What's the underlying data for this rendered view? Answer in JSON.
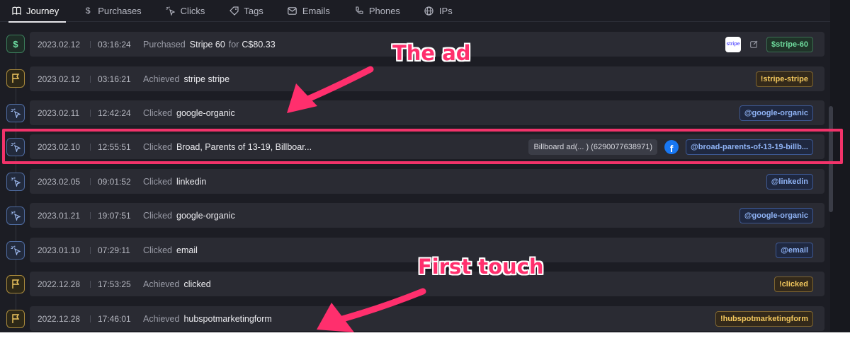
{
  "tabs": [
    {
      "label": "Journey",
      "icon": "book-icon"
    },
    {
      "label": "Purchases",
      "icon": "dollar-icon"
    },
    {
      "label": "Clicks",
      "icon": "pointer-click-icon"
    },
    {
      "label": "Tags",
      "icon": "tag-icon"
    },
    {
      "label": "Emails",
      "icon": "mail-icon"
    },
    {
      "label": "Phones",
      "icon": "phone-icon"
    },
    {
      "label": "IPs",
      "icon": "globe-icon"
    }
  ],
  "events": [
    {
      "type": "purchase",
      "date": "2023.02.12",
      "time": "03:16:24",
      "verb": "Purchased",
      "object": "Stripe 60",
      "for_text": "for",
      "amount": "C$80.33",
      "logo": "stripe",
      "tag": "$stripe-60",
      "tag_color": "green"
    },
    {
      "type": "achieve",
      "date": "2023.02.12",
      "time": "03:16:21",
      "verb": "Achieved",
      "object": "stripe stripe",
      "tag": "!stripe-stripe",
      "tag_color": "yellow"
    },
    {
      "type": "click",
      "date": "2023.02.11",
      "time": "12:42:24",
      "verb": "Clicked",
      "object": "google-organic",
      "tag": "@google-organic",
      "tag_color": "blue"
    },
    {
      "type": "click",
      "date": "2023.02.10",
      "time": "12:55:51",
      "verb": "Clicked",
      "object": "Broad, Parents of 13-19, Billboar...",
      "ad_label": "Billboard ad(... ) (6290077638971)",
      "tag": "@broad-parents-of-13-19-billb...",
      "tag_color": "blue"
    },
    {
      "type": "click",
      "date": "2023.02.05",
      "time": "09:01:52",
      "verb": "Clicked",
      "object": "linkedin",
      "tag": "@linkedin",
      "tag_color": "blue"
    },
    {
      "type": "click",
      "date": "2023.01.21",
      "time": "19:07:51",
      "verb": "Clicked",
      "object": "google-organic",
      "tag": "@google-organic",
      "tag_color": "blue"
    },
    {
      "type": "click",
      "date": "2023.01.10",
      "time": "07:29:11",
      "verb": "Clicked",
      "object": "email",
      "tag": "@email",
      "tag_color": "blue"
    },
    {
      "type": "achieve",
      "date": "2022.12.28",
      "time": "17:53:25",
      "verb": "Achieved",
      "object": "clicked",
      "tag": "!clicked",
      "tag_color": "yellow"
    },
    {
      "type": "achieve",
      "date": "2022.12.28",
      "time": "17:46:01",
      "verb": "Achieved",
      "object": "hubspotmarketingform",
      "tag": "!hubspotmarketingform",
      "tag_color": "yellow"
    }
  ],
  "stripe_logo_text": "stripe",
  "annotations": {
    "ad": "The ad",
    "first_touch": "First touch"
  },
  "colors": {
    "highlight": "#f2336a",
    "annotation": "#ff2f6d",
    "background": "#1c1d24",
    "row": "#2a2b33"
  }
}
